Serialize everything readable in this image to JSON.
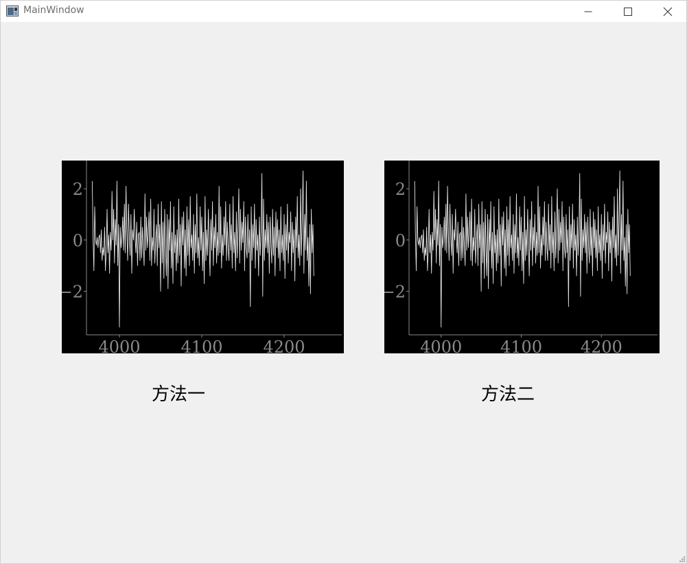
{
  "window": {
    "title": "MainWindow",
    "controls": {
      "minimize": "minimize-icon",
      "maximize": "maximize-icon",
      "close": "close-icon"
    }
  },
  "captions": {
    "method_one": "方法一",
    "method_two": "方法二"
  },
  "colors": {
    "plot_background": "#000000",
    "plot_line": "#e6e6e6",
    "axis": "#8a8a8a",
    "window_background": "#f0f0f0"
  },
  "chart_data": [
    {
      "type": "line",
      "xlim": [
        3960,
        4270
      ],
      "ylim": [
        -3.7,
        3.1
      ],
      "x_ticks": [
        4000,
        4100,
        4200
      ],
      "y_ticks": [
        2,
        0,
        -2
      ],
      "x_tick_labels": [
        "4000",
        "4100",
        "4200"
      ],
      "y_tick_labels": [
        "2",
        "0",
        "−2"
      ],
      "x_start": 3967,
      "x_step": 1,
      "values": [
        2.3,
        0.1,
        -1.2,
        1.3,
        0.0,
        -0.2,
        0.1,
        -0.3,
        0.1,
        0.2,
        -0.5,
        0.4,
        -0.8,
        -0.3,
        -0.6,
        0.5,
        -1.2,
        -0.4,
        1.2,
        -0.5,
        0.2,
        -1.3,
        0.3,
        -0.4,
        1.9,
        0.0,
        1.2,
        -0.9,
        0.8,
        -0.2,
        2.3,
        -1.0,
        0.6,
        -3.4,
        0.5,
        -0.3,
        0.1,
        0.9,
        -0.4,
        1.4,
        -0.5,
        2.1,
        0.3,
        -0.8,
        1.4,
        0.2,
        -0.6,
        1.0,
        -1.3,
        0.4,
        0.0,
        1.2,
        0.1,
        -0.5,
        0.7,
        -1.0,
        0.2,
        0.3,
        -0.8,
        0.9,
        -0.7,
        0.5,
        -0.2,
        -1.0,
        1.8,
        -0.4,
        0.9,
        -0.3,
        0.3,
        1.1,
        -0.8,
        1.6,
        -1.0,
        0.1,
        -0.4,
        1.2,
        -0.9,
        0.0,
        0.6,
        -1.0,
        1.4,
        -0.3,
        0.6,
        -2.0,
        1.5,
        -0.9,
        0.7,
        -1.5,
        1.2,
        -0.3,
        -1.4,
        1.0,
        -1.9,
        0.8,
        -0.4,
        1.5,
        -1.1,
        0.3,
        -1.7,
        1.3,
        -0.5,
        0.2,
        -1.2,
        0.4,
        -0.9,
        1.6,
        -0.6,
        0.6,
        -1.8,
        0.9,
        -0.2,
        1.1,
        -1.1,
        0.4,
        -1.4,
        1.3,
        -0.6,
        0.8,
        -1.0,
        1.7,
        -0.3,
        0.2,
        -0.8,
        1.0,
        -1.3,
        0.6,
        -0.5,
        1.8,
        -0.7,
        0.1,
        -1.0,
        1.3,
        -0.4,
        0.9,
        -1.2,
        0.3,
        -1.7,
        1.7,
        -0.8,
        0.4,
        -0.6,
        1.2,
        -0.1,
        -1.4,
        0.8,
        -0.4,
        1.5,
        -1.0,
        0.5,
        -0.3,
        1.0,
        -0.9,
        0.3,
        -0.6,
        2.1,
        -0.5,
        1.3,
        -1.1,
        0.2,
        -0.6,
        0.9,
        -0.2,
        1.5,
        -0.8,
        0.7,
        -0.3,
        -0.8,
        1.4,
        -0.4,
        0.6,
        -1.1,
        1.7,
        -0.5,
        0.3,
        -1.2,
        1.1,
        -0.7,
        0.5,
        2.0,
        -0.9,
        1.2,
        -0.4,
        0.7,
        -0.1,
        1.5,
        -1.2,
        0.9,
        -0.3,
        -0.7,
        1.0,
        -0.5,
        0.4,
        -2.6,
        1.3,
        -0.8,
        0.6,
        -0.3,
        1.4,
        -1.1,
        0.8,
        -0.4,
        0.2,
        -1.4,
        0.9,
        -0.6,
        0.3,
        2.6,
        -2.2,
        1.6,
        -0.8,
        0.4,
        -0.3,
        1.0,
        -0.5,
        0.7,
        -1.3,
        0.9,
        -0.2,
        -0.9,
        1.2,
        -0.6,
        0.5,
        -1.4,
        1.1,
        -0.3,
        0.8,
        -0.7,
        0.4,
        -1.2,
        1.3,
        -0.5,
        0.2,
        -0.8,
        1.0,
        -1.5,
        0.6,
        -0.4,
        1.4,
        -0.9,
        0.3,
        -0.1,
        1.1,
        -1.2,
        0.7,
        -0.5,
        0.4,
        -1.6,
        0.9,
        -0.3,
        1.7,
        -0.7,
        0.2,
        -1.0,
        2.0,
        -0.6,
        0.8,
        2.7,
        -1.3,
        1.0,
        -0.4,
        2.3,
        -0.8,
        0.1,
        -1.8,
        0.6,
        -2.1,
        1.2,
        -0.5,
        0.6,
        -1.4
      ]
    },
    {
      "type": "line",
      "xlim": [
        3960,
        4270
      ],
      "ylim": [
        -3.7,
        3.1
      ],
      "x_ticks": [
        4000,
        4100,
        4200
      ],
      "y_ticks": [
        2,
        0,
        -2
      ],
      "x_tick_labels": [
        "4000",
        "4100",
        "4200"
      ],
      "y_tick_labels": [
        "2",
        "0",
        "−2"
      ],
      "x_start": 3967,
      "x_step": 1,
      "values": [
        2.3,
        0.1,
        -1.2,
        1.3,
        0.0,
        -0.2,
        0.1,
        -0.3,
        0.1,
        0.2,
        -0.5,
        0.4,
        -0.8,
        -0.3,
        -0.6,
        0.5,
        -1.2,
        -0.4,
        1.2,
        -0.5,
        0.2,
        -1.3,
        0.3,
        -0.4,
        1.9,
        0.0,
        1.2,
        -0.9,
        0.8,
        -0.2,
        2.3,
        -1.0,
        0.6,
        -3.4,
        0.5,
        -0.3,
        0.1,
        0.9,
        -0.4,
        1.4,
        -0.5,
        2.1,
        0.3,
        -0.8,
        1.4,
        0.2,
        -0.6,
        1.0,
        -1.3,
        0.4,
        0.0,
        1.2,
        0.1,
        -0.5,
        0.7,
        -1.0,
        0.2,
        0.3,
        -0.8,
        0.9,
        -0.7,
        0.5,
        -0.2,
        -1.0,
        1.8,
        -0.4,
        0.9,
        -0.3,
        0.3,
        1.1,
        -0.8,
        1.6,
        -1.0,
        0.1,
        -0.4,
        1.2,
        -0.9,
        0.0,
        0.6,
        -1.0,
        1.4,
        -0.3,
        0.6,
        -2.0,
        1.5,
        -0.9,
        0.7,
        -1.5,
        1.2,
        -0.3,
        -1.4,
        1.0,
        -1.9,
        0.8,
        -0.4,
        1.5,
        -1.1,
        0.3,
        -1.7,
        1.3,
        -0.5,
        0.2,
        -1.2,
        0.4,
        -0.9,
        1.6,
        -0.6,
        0.6,
        -1.8,
        0.9,
        -0.2,
        1.1,
        -1.1,
        0.4,
        -1.4,
        1.3,
        -0.6,
        0.8,
        -1.0,
        1.7,
        -0.3,
        0.2,
        -0.8,
        1.0,
        -1.3,
        0.6,
        -0.5,
        1.8,
        -0.7,
        0.1,
        -1.0,
        1.3,
        -0.4,
        0.9,
        -1.2,
        0.3,
        -1.7,
        1.7,
        -0.8,
        0.4,
        -0.6,
        1.2,
        -0.1,
        -1.4,
        0.8,
        -0.4,
        1.5,
        -1.0,
        0.5,
        -0.3,
        1.0,
        -0.9,
        0.3,
        -0.6,
        2.1,
        -0.5,
        1.3,
        -1.1,
        0.2,
        -0.6,
        0.9,
        -0.2,
        1.5,
        -0.8,
        0.7,
        -0.3,
        -0.8,
        1.4,
        -0.4,
        0.6,
        -1.1,
        1.7,
        -0.5,
        0.3,
        -1.2,
        1.1,
        -0.7,
        0.5,
        2.0,
        -0.9,
        1.2,
        -0.4,
        0.7,
        -0.1,
        1.5,
        -1.2,
        0.9,
        -0.3,
        -0.7,
        1.0,
        -0.5,
        0.4,
        -2.6,
        1.3,
        -0.8,
        0.6,
        -0.3,
        1.4,
        -1.1,
        0.8,
        -0.4,
        0.2,
        -1.4,
        0.9,
        -0.6,
        0.3,
        2.6,
        -2.2,
        1.6,
        -0.8,
        0.4,
        -0.3,
        1.0,
        -0.5,
        0.7,
        -1.3,
        0.9,
        -0.2,
        -0.9,
        1.2,
        -0.6,
        0.5,
        -1.4,
        1.1,
        -0.3,
        0.8,
        -0.7,
        0.4,
        -1.2,
        1.3,
        -0.5,
        0.2,
        -0.8,
        1.0,
        -1.5,
        0.6,
        -0.4,
        1.4,
        -0.9,
        0.3,
        -0.1,
        1.1,
        -1.2,
        0.7,
        -0.5,
        0.4,
        -1.6,
        0.9,
        -0.3,
        1.7,
        -0.7,
        0.2,
        -1.0,
        2.0,
        -0.6,
        0.8,
        2.7,
        -1.3,
        1.0,
        -0.4,
        2.3,
        -0.8,
        0.1,
        -1.8,
        0.6,
        -2.1,
        1.2,
        -0.5,
        0.6,
        -1.4
      ]
    }
  ]
}
